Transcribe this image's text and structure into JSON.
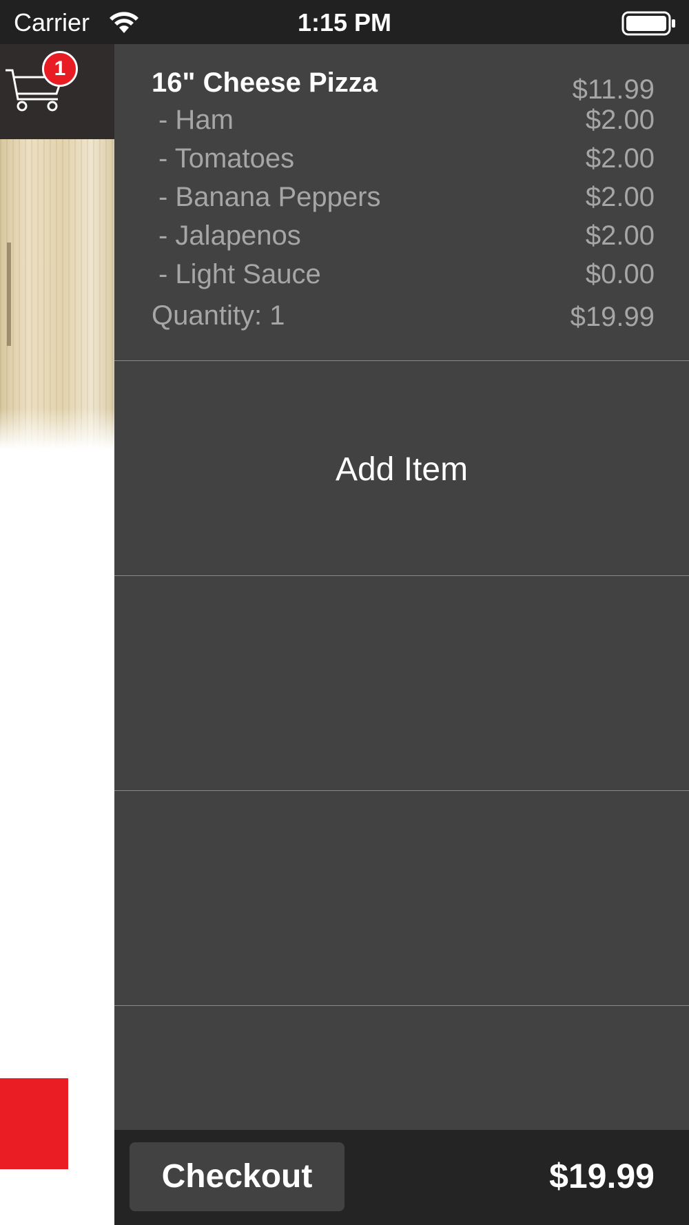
{
  "status_bar": {
    "carrier": "Carrier",
    "time": "1:15 PM"
  },
  "cart_button": {
    "icon": "shopping-cart-icon",
    "badge_count": "1"
  },
  "cart": {
    "item": {
      "name": "16\" Cheese Pizza",
      "price": "$11.99",
      "toppings": [
        {
          "name": "- Ham",
          "price": "$2.00"
        },
        {
          "name": "- Tomatoes",
          "price": "$2.00"
        },
        {
          "name": "- Banana Peppers",
          "price": "$2.00"
        },
        {
          "name": "- Jalapenos",
          "price": "$2.00"
        },
        {
          "name": "- Light Sauce",
          "price": "$0.00"
        }
      ],
      "quantity_label": "Quantity: 1",
      "total": "$19.99"
    },
    "add_item_label": "Add Item"
  },
  "footer": {
    "checkout_label": "Checkout",
    "total": "$19.99"
  },
  "colors": {
    "drawer_bg": "#424242",
    "footer_bg": "#242424",
    "badge_red": "#e81d24",
    "accent_red": "#ea1d25",
    "muted_text": "#a6a6a6"
  }
}
